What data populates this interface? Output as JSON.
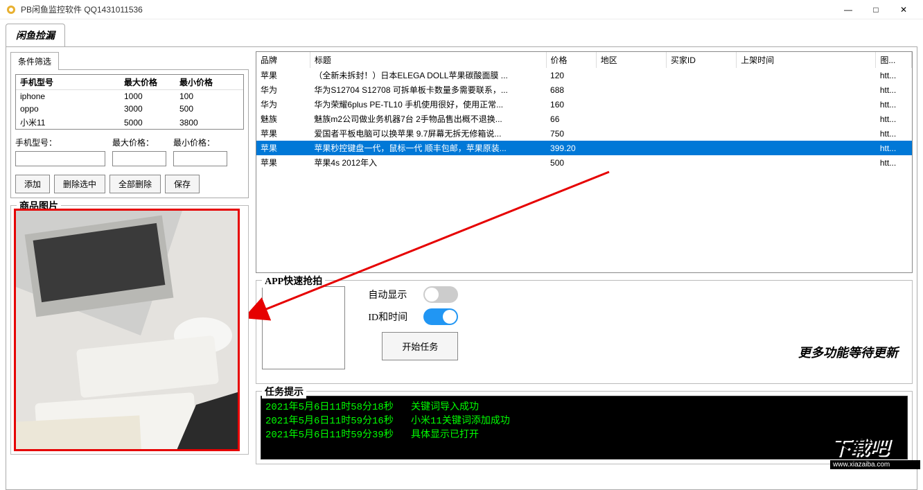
{
  "window": {
    "title": "PB闲鱼监控软件 QQ1431011536",
    "minimize": "—",
    "maximize": "□",
    "close": "✕"
  },
  "mainTab": "闲鱼捡漏",
  "filter": {
    "tab": "条件筛选",
    "cols": {
      "model": "手机型号",
      "max": "最大价格",
      "min": "最小价格"
    },
    "rows": [
      {
        "model": "iphone",
        "max": "1000",
        "min": "100"
      },
      {
        "model": "oppo",
        "max": "3000",
        "min": "500"
      },
      {
        "model": "小米11",
        "max": "5000",
        "min": "3800"
      }
    ],
    "inputLabels": {
      "model": "手机型号：",
      "max": "最大价格：",
      "min": "最小价格："
    },
    "buttons": {
      "add": "添加",
      "delSel": "删除选中",
      "delAll": "全部删除",
      "save": "保存"
    }
  },
  "productImage": {
    "legend": "商品图片"
  },
  "results": {
    "cols": {
      "brand": "品牌",
      "title": "标题",
      "price": "价格",
      "region": "地区",
      "buyer": "买家ID",
      "listed": "上架时间",
      "img": "图..."
    },
    "rows": [
      {
        "brand": "苹果",
        "title": "（全新未拆封！）日本ELEGA DOLL苹果碳酸面膜 ...",
        "price": "120",
        "img": "htt..."
      },
      {
        "brand": "华为",
        "title": "华为S12704 S12708 可拆单板卡数量多需要联系，...",
        "price": "688",
        "img": "htt..."
      },
      {
        "brand": "华为",
        "title": "华为荣耀6plus PE-TL10 手机使用很好，使用正常...",
        "price": "160",
        "img": "htt..."
      },
      {
        "brand": "魅族",
        "title": "魅族m2公司做业务机器7台   2手物品售出概不退换...",
        "price": "66",
        "img": "htt..."
      },
      {
        "brand": "苹果",
        "title": "爱国者平板电脑可以换苹果 9.7屏幕无拆无修箱说...",
        "price": "750",
        "img": "htt..."
      },
      {
        "brand": "苹果",
        "title": "苹果秒控键盘一代，鼠标一代 顺丰包邮，苹果原装...",
        "price": "399.20",
        "img": "htt...",
        "selected": true
      },
      {
        "brand": "苹果",
        "title": "苹果4s 2012年入",
        "price": "500",
        "img": "htt..."
      }
    ]
  },
  "app": {
    "legend": "APP快速抢拍",
    "autoShow": "自动显示",
    "idTime": "ID和时间",
    "start": "开始任务",
    "more": "更多功能等待更新"
  },
  "task": {
    "legend": "任务提示",
    "lines": [
      "2021年5月6日11时58分18秒   关键词导入成功",
      "2021年5月6日11时59分16秒   小米11关键词添加成功",
      "2021年5月6日11时59分39秒   具体显示已打开"
    ]
  },
  "watermark": {
    "logo": "下载吧",
    "url": "www.xiazaiba.com"
  }
}
